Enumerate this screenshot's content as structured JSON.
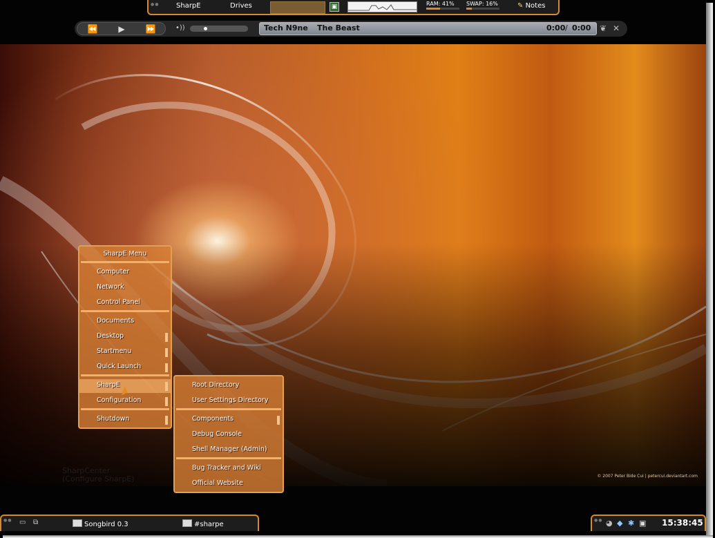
{
  "topbar": {
    "sharpe_label": "SharpE",
    "drives_label": "Drives",
    "ram_label": "RAM: 41%",
    "ram_percent": 41,
    "swap_label": "SWAP: 16%",
    "swap_percent": 16,
    "notes_label": "Notes"
  },
  "media": {
    "artist": "Tech N9ne",
    "track": "The Beast",
    "elapsed": "0:00",
    "separator": "/",
    "duration": "0:00",
    "seek_fraction": 0.25
  },
  "main_menu": {
    "title": "SharpE Menu",
    "group1": [
      "Computer",
      "Network",
      "Control Panel"
    ],
    "group2": [
      "Documents",
      "Desktop",
      "Startmenu",
      "Quick Launch"
    ],
    "group3": [
      "SharpE",
      "Configuration"
    ],
    "group4": [
      "Shutdown"
    ]
  },
  "submenu": {
    "group1": [
      "Root Directory",
      "User Settings Directory"
    ],
    "group2": [
      "Components",
      "Debug Console",
      "Shell Manager (Admin)"
    ],
    "group3": [
      "Bug Tracker and Wiki",
      "Official Website"
    ]
  },
  "desktop": {
    "sharpcenter_line1": "SharpCenter",
    "sharpcenter_line2": "(Configure SharpE)",
    "credit": "© 2007 Peter Bide Cui | petercui.deviantart.com"
  },
  "taskbar": {
    "task1": "Songbird 0.3",
    "task2": "#sharpe",
    "clock": "15:38:45"
  },
  "colors": {
    "accent": "#d9892a",
    "bar_bg": "#1d1d1d"
  }
}
